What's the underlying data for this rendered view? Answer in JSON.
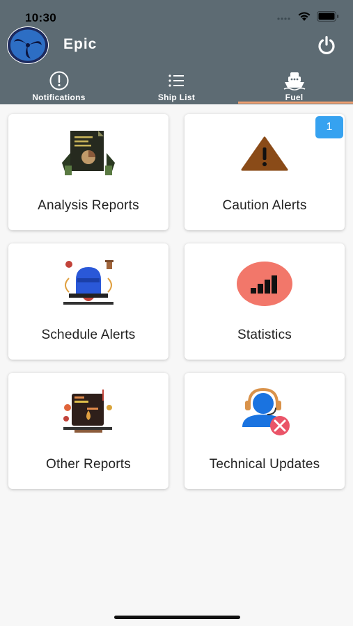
{
  "status_bar": {
    "time": "10:30",
    "icons": [
      "signal-icon",
      "wifi-icon",
      "battery-icon"
    ]
  },
  "app": {
    "title": "Epic",
    "logo": "epic-logo",
    "power_icon": "power-icon"
  },
  "tabs": [
    {
      "label": "Notifications",
      "icon": "exclamation-circle-icon",
      "selected": false
    },
    {
      "label": "Ship List",
      "icon": "list-icon",
      "selected": false
    },
    {
      "label": "Fuel",
      "icon": "ship-icon",
      "selected": true
    }
  ],
  "cards": [
    {
      "label": "Analysis Reports",
      "icon": "analysis-report-icon"
    },
    {
      "label": "Caution Alerts",
      "icon": "warning-icon",
      "badge": "1"
    },
    {
      "label": "Schedule Alerts",
      "icon": "alarm-bell-icon"
    },
    {
      "label": "Statistics",
      "icon": "bar-chart-icon"
    },
    {
      "label": "Other Reports",
      "icon": "reports-icon"
    },
    {
      "label": "Technical Updates",
      "icon": "support-agent-icon"
    }
  ],
  "colors": {
    "header": "#5d6b73",
    "tab_indicator": "#f0a070",
    "badge": "#36a2f0",
    "background": "#f7f7f7"
  }
}
